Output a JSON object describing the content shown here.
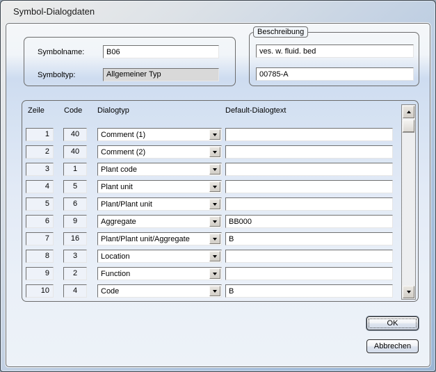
{
  "window": {
    "title": "Symbol-Dialogdaten"
  },
  "symbol_group": {
    "name_label": "Symbolname:",
    "name_value": "B06",
    "type_label": "Symboltyp:",
    "type_value": "Allgemeiner Typ"
  },
  "description_group": {
    "title": "Beschreibung",
    "line1": "ves. w. fluid. bed",
    "line2": "00785-A"
  },
  "table": {
    "headers": {
      "zeile": "Zeile",
      "code": "Code",
      "dialogtyp": "Dialogtyp",
      "default": "Default-Dialogtext"
    },
    "rows": [
      {
        "zeile": "1",
        "code": "40",
        "dialogtyp": "Comment (1)",
        "default": ""
      },
      {
        "zeile": "2",
        "code": "40",
        "dialogtyp": "Comment (2)",
        "default": ""
      },
      {
        "zeile": "3",
        "code": "1",
        "dialogtyp": "Plant code",
        "default": ""
      },
      {
        "zeile": "4",
        "code": "5",
        "dialogtyp": "Plant unit",
        "default": ""
      },
      {
        "zeile": "5",
        "code": "6",
        "dialogtyp": "Plant/Plant unit",
        "default": ""
      },
      {
        "zeile": "6",
        "code": "9",
        "dialogtyp": "Aggregate",
        "default": "BB000"
      },
      {
        "zeile": "7",
        "code": "16",
        "dialogtyp": "Plant/Plant unit/Aggregate",
        "default": "B"
      },
      {
        "zeile": "8",
        "code": "3",
        "dialogtyp": "Location",
        "default": ""
      },
      {
        "zeile": "9",
        "code": "2",
        "dialogtyp": "Function",
        "default": ""
      },
      {
        "zeile": "10",
        "code": "4",
        "dialogtyp": "Code",
        "default": "B"
      }
    ]
  },
  "buttons": {
    "ok": "OK",
    "cancel": "Abbrechen"
  },
  "colors": {
    "frame_blue": "#9cb6d4",
    "client_top": "#f5f7f9",
    "client_band": "#cedcf0",
    "client_bottom": "#edf2f8",
    "disabled_field": "#d9d9d9",
    "border_dark": "#6d6d6d"
  }
}
